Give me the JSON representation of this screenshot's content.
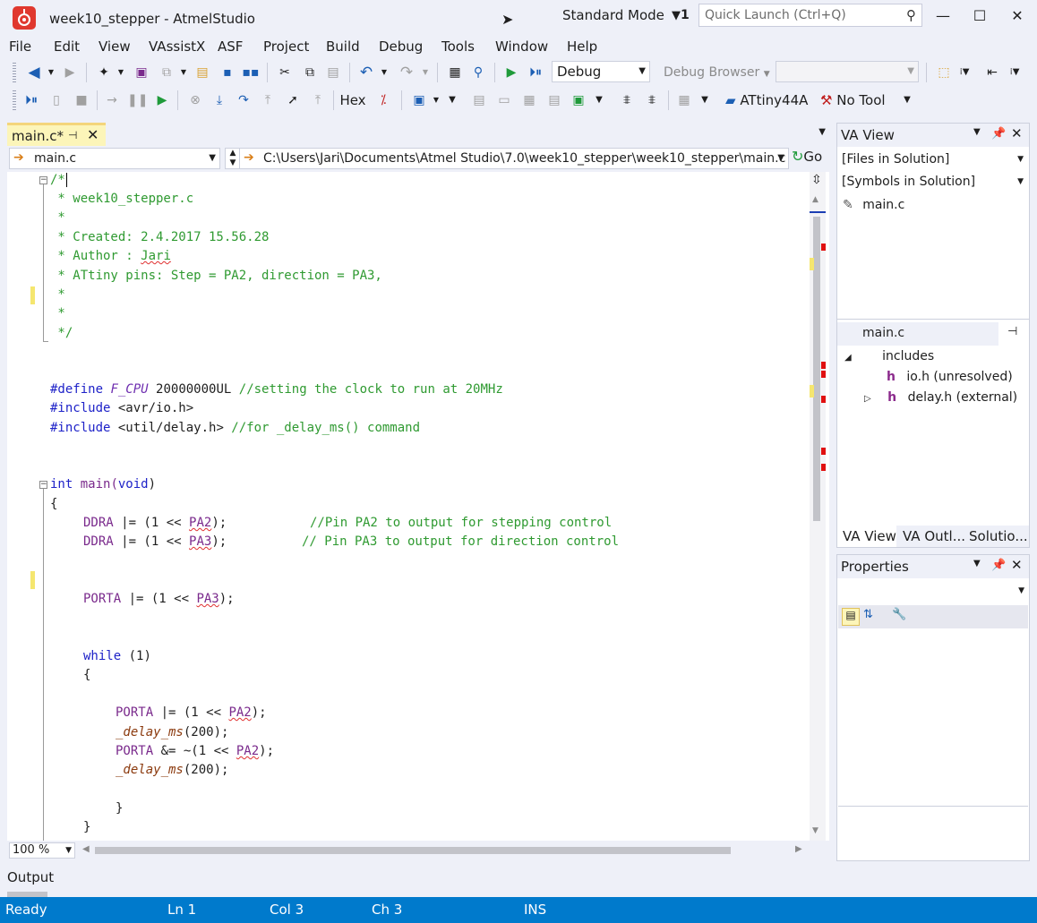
{
  "window": {
    "title": "week10_stepper - AtmelStudio",
    "mode": "Standard Mode",
    "notifications": "1",
    "quick_launch_placeholder": "Quick Launch (Ctrl+Q)",
    "minimize": "—",
    "maximize": "☐",
    "close": "✕"
  },
  "menu": [
    "File",
    "Edit",
    "View",
    "VAssistX",
    "ASF",
    "Project",
    "Build",
    "Debug",
    "Tools",
    "Window",
    "Help"
  ],
  "toolbar": {
    "config": "Debug",
    "debug_browser": "Debug Browser",
    "hex_label": "Hex",
    "device": "ATtiny44A",
    "tool": "No Tool"
  },
  "tab": {
    "label": "main.c*",
    "pin": "⊣",
    "close": "✕"
  },
  "navbar": {
    "function_combo": "main.c",
    "path": "C:\\Users\\Jari\\Documents\\Atmel Studio\\7.0\\week10_stepper\\week10_stepper\\main.c",
    "go_label": "Go"
  },
  "code": {
    "lines": {
      "l1": "/*",
      "l2": " * week10_stepper.c",
      "l3": " *",
      "l4": " * Created: 2.4.2017 15.56.28",
      "l5_prefix": " * Author : ",
      "l5_name": "Jari",
      "l6": " * ATtiny pins: Step = PA2, direction = PA3,",
      "l7": " *",
      "l8": " *",
      "l9": " */",
      "define_kw": "#define",
      "define_name": "F_CPU",
      "define_val": " 20000000UL ",
      "define_comment": "//setting the clock to run at 20MHz",
      "inc1_kw": "#include",
      "inc1_val": " <avr/io.h>",
      "inc2_kw": "#include",
      "inc2_val": " <util/delay.h> ",
      "inc2_comment": "//for _delay_ms() command",
      "main_kw": "int",
      "main_name": " main(",
      "main_void": "void",
      "main_close": ")",
      "brace_open": "{",
      "ddra1_reg": "DDRA",
      "ddra1_op": " |= (1 << ",
      "ddra1_pin": "PA2",
      "ddra1_end": ");",
      "ddra1_comment": "//Pin PA2 to output for stepping control",
      "ddra2_reg": "DDRA",
      "ddra2_op": " |= (1 << ",
      "ddra2_pin": "PA3",
      "ddra2_end": ");",
      "ddra2_comment": "// Pin PA3 to output for direction control",
      "porta_reg": "PORTA",
      "porta_op": " |= (1 << ",
      "porta_pin": "PA3",
      "porta_end": ");",
      "while_kw": "while",
      "while_cond": " (1)",
      "inner_open": "{",
      "p1_reg": "PORTA",
      "p1_op": " |= (1 << ",
      "p1_pin": "PA2",
      "p1_end": ");",
      "d1_fn": "_delay_ms",
      "d1_arg": "(200);",
      "p2_reg": "PORTA",
      "p2_op": " &= ~(1 << ",
      "p2_pin": "PA2",
      "p2_end": ");",
      "d2_fn": "_delay_ms",
      "d2_arg": "(200);",
      "inner_close": "}",
      "outer_close": "}"
    }
  },
  "editor": {
    "zoom": "100 %"
  },
  "va_view": {
    "title": "VA View",
    "files_combo": "[Files in Solution]",
    "symbols_combo": "[Symbols in Solution]",
    "file_item": "main.c",
    "outline_file": "main.c",
    "includes_label": "includes",
    "include_items": [
      "io.h (unresolved)",
      "delay.h (external)"
    ],
    "tabs": [
      "VA View",
      "VA Outl...",
      "Solutio..."
    ]
  },
  "properties": {
    "title": "Properties"
  },
  "output": {
    "label": "Output"
  },
  "status": {
    "ready": "Ready",
    "ln": "Ln 1",
    "col": "Col 3",
    "ch": "Ch 3",
    "ins": "INS"
  },
  "colors": {
    "accent": "#007acc",
    "tab_active": "#fcf5b9",
    "comment": "#2f9a31",
    "keyword": "#1e22c8",
    "macro": "#7a2a8c",
    "error_marker": "#e01010"
  }
}
